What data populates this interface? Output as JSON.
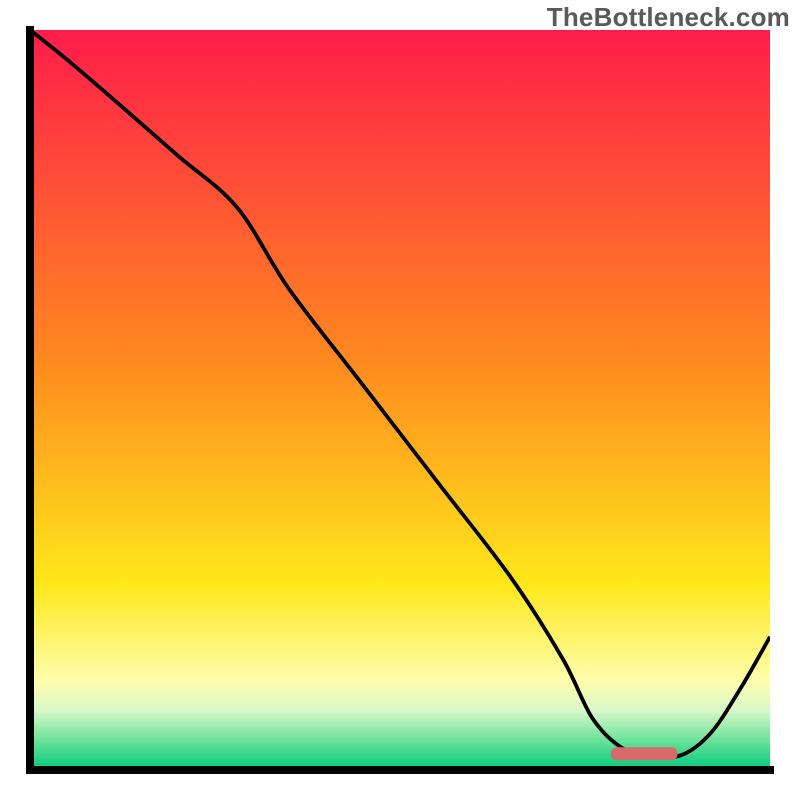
{
  "watermark": "TheBottleneck.com",
  "chart_data": {
    "type": "line",
    "title": "",
    "xlabel": "",
    "ylabel": "",
    "xlim": [
      0,
      100
    ],
    "ylim": [
      0,
      100
    ],
    "grid": false,
    "legend": false,
    "gradient_bands": [
      {
        "y_from": 100,
        "y_to": 55,
        "color_top": "#ff1c4a",
        "color_bottom": "#ff8a1f"
      },
      {
        "y_from": 55,
        "y_to": 25,
        "color_top": "#ff8a1f",
        "color_bottom": "#ffe81a"
      },
      {
        "y_from": 25,
        "y_to": 12,
        "color_top": "#ffe81a",
        "color_bottom": "#fffeae"
      },
      {
        "y_from": 12,
        "y_to": 8,
        "color_top": "#fffeae",
        "color_bottom": "#d7f8c8"
      },
      {
        "y_from": 8,
        "y_to": 4,
        "color_top": "#d7f8c8",
        "color_bottom": "#6be29a"
      },
      {
        "y_from": 4,
        "y_to": 0,
        "color_top": "#6be29a",
        "color_bottom": "#00c97b"
      }
    ],
    "series": [
      {
        "name": "bottleneck-curve",
        "x": [
          0,
          5,
          12,
          20,
          28,
          35,
          45,
          55,
          65,
          72,
          76,
          80,
          84,
          88,
          92,
          96,
          100
        ],
        "y": [
          100,
          96,
          90,
          83,
          76,
          65,
          52,
          39,
          26,
          15,
          7,
          3,
          2,
          2,
          5,
          11,
          18
        ]
      }
    ],
    "marker": {
      "name": "optimal-range-marker",
      "x_center": 83,
      "x_halfwidth": 4.5,
      "y": 2.2,
      "color": "#d86a6d"
    },
    "axis_color": "#000000",
    "axis_width": 5
  }
}
